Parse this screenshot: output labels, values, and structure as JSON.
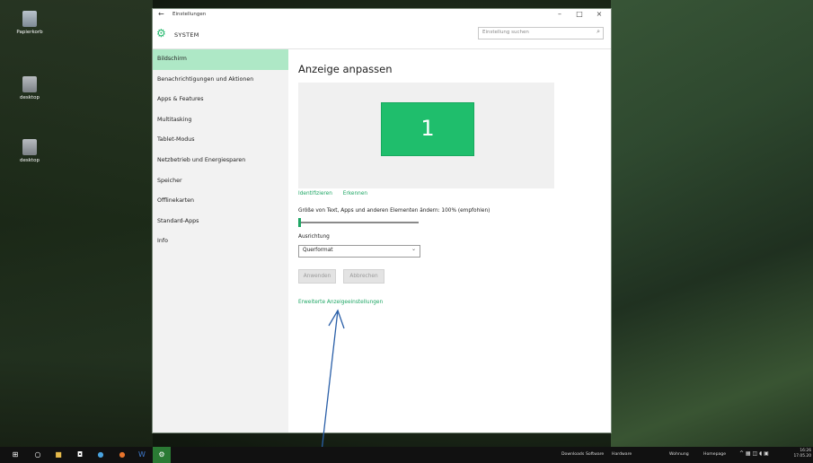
{
  "desktop": {
    "icons": [
      {
        "label": "Papierkorb",
        "icon": "recycle-bin-icon"
      },
      {
        "label": "desktop",
        "icon": "file-icon"
      },
      {
        "label": "desktop",
        "icon": "file-icon"
      }
    ]
  },
  "window": {
    "title": "Einstellungen",
    "back_icon": "←",
    "minimize": "–",
    "maximize": "□",
    "close": "×",
    "section": "SYSTEM",
    "search": {
      "placeholder": "Einstellung suchen",
      "icon": "⌕"
    }
  },
  "sidebar": {
    "items": [
      {
        "label": "Bildschirm",
        "active": true
      },
      {
        "label": "Benachrichtigungen und Aktionen"
      },
      {
        "label": "Apps & Features"
      },
      {
        "label": "Multitasking"
      },
      {
        "label": "Tablet-Modus"
      },
      {
        "label": "Netzbetrieb und Energiesparen"
      },
      {
        "label": "Speicher"
      },
      {
        "label": "Offlinekarten"
      },
      {
        "label": "Standard-Apps"
      },
      {
        "label": "Info"
      }
    ]
  },
  "display": {
    "title": "Anzeige anpassen",
    "monitor_number": "1",
    "identify": "Identifizieren",
    "detect": "Erkennen",
    "scale_label": "Größe von Text, Apps und anderen Elementen ändern: 100% (empfohlen)",
    "scale_slider_fraction": 0.0,
    "orientation_label": "Ausrichtung",
    "orientation_value": "Querformat",
    "apply": "Anwenden",
    "cancel": "Abbrechen",
    "advanced_link": "Erweiterte Anzeigeeinstellungen"
  },
  "taskbar": {
    "links": [
      "Downloads",
      "Software",
      "Hardware",
      "Wohnung",
      "Homepage"
    ],
    "time": "16:26",
    "date": "17.05.20"
  },
  "colors": {
    "accent": "#1ea664",
    "selected_nav": "#aee8c6",
    "arrow": "#2a5fa8"
  }
}
